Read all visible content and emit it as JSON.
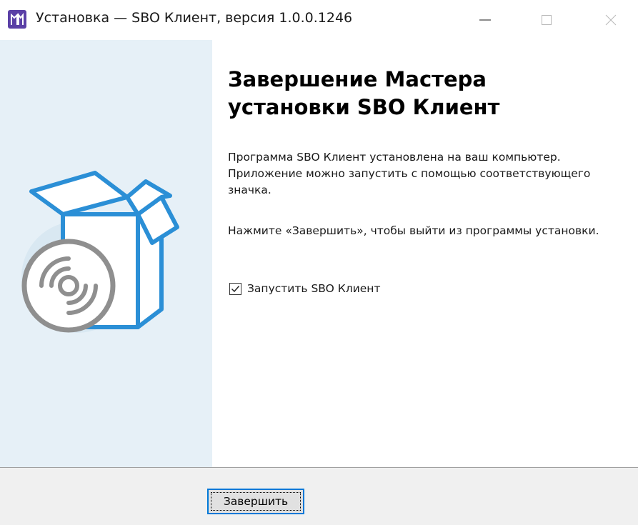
{
  "window": {
    "title": "Установка — SBO Клиент, версия 1.0.0.1246",
    "app_icon": "installer-app-icon",
    "controls": [
      "minimize-icon",
      "maximize-icon",
      "close-icon"
    ]
  },
  "sidebar": {
    "illustration": "software-box-with-disc"
  },
  "content": {
    "heading": "Завершение Мастера установки SBO Клиент",
    "paragraph1": "Программа SBO Клиент установлена на ваш компьютер. Приложение можно запустить с помощью соответствующего значка.",
    "paragraph2": "Нажмите «Завершить», чтобы выйти из программы установки.",
    "launch_checkbox": {
      "label": "Запустить SBO Клиент",
      "checked": true
    }
  },
  "footer": {
    "finish_label": "Завершить"
  },
  "colors": {
    "sidebar_bg": "#e6f0f7",
    "box_outline": "#2b8fd6",
    "disc": "#8f8f8f",
    "focus_accent": "#0078d7"
  }
}
